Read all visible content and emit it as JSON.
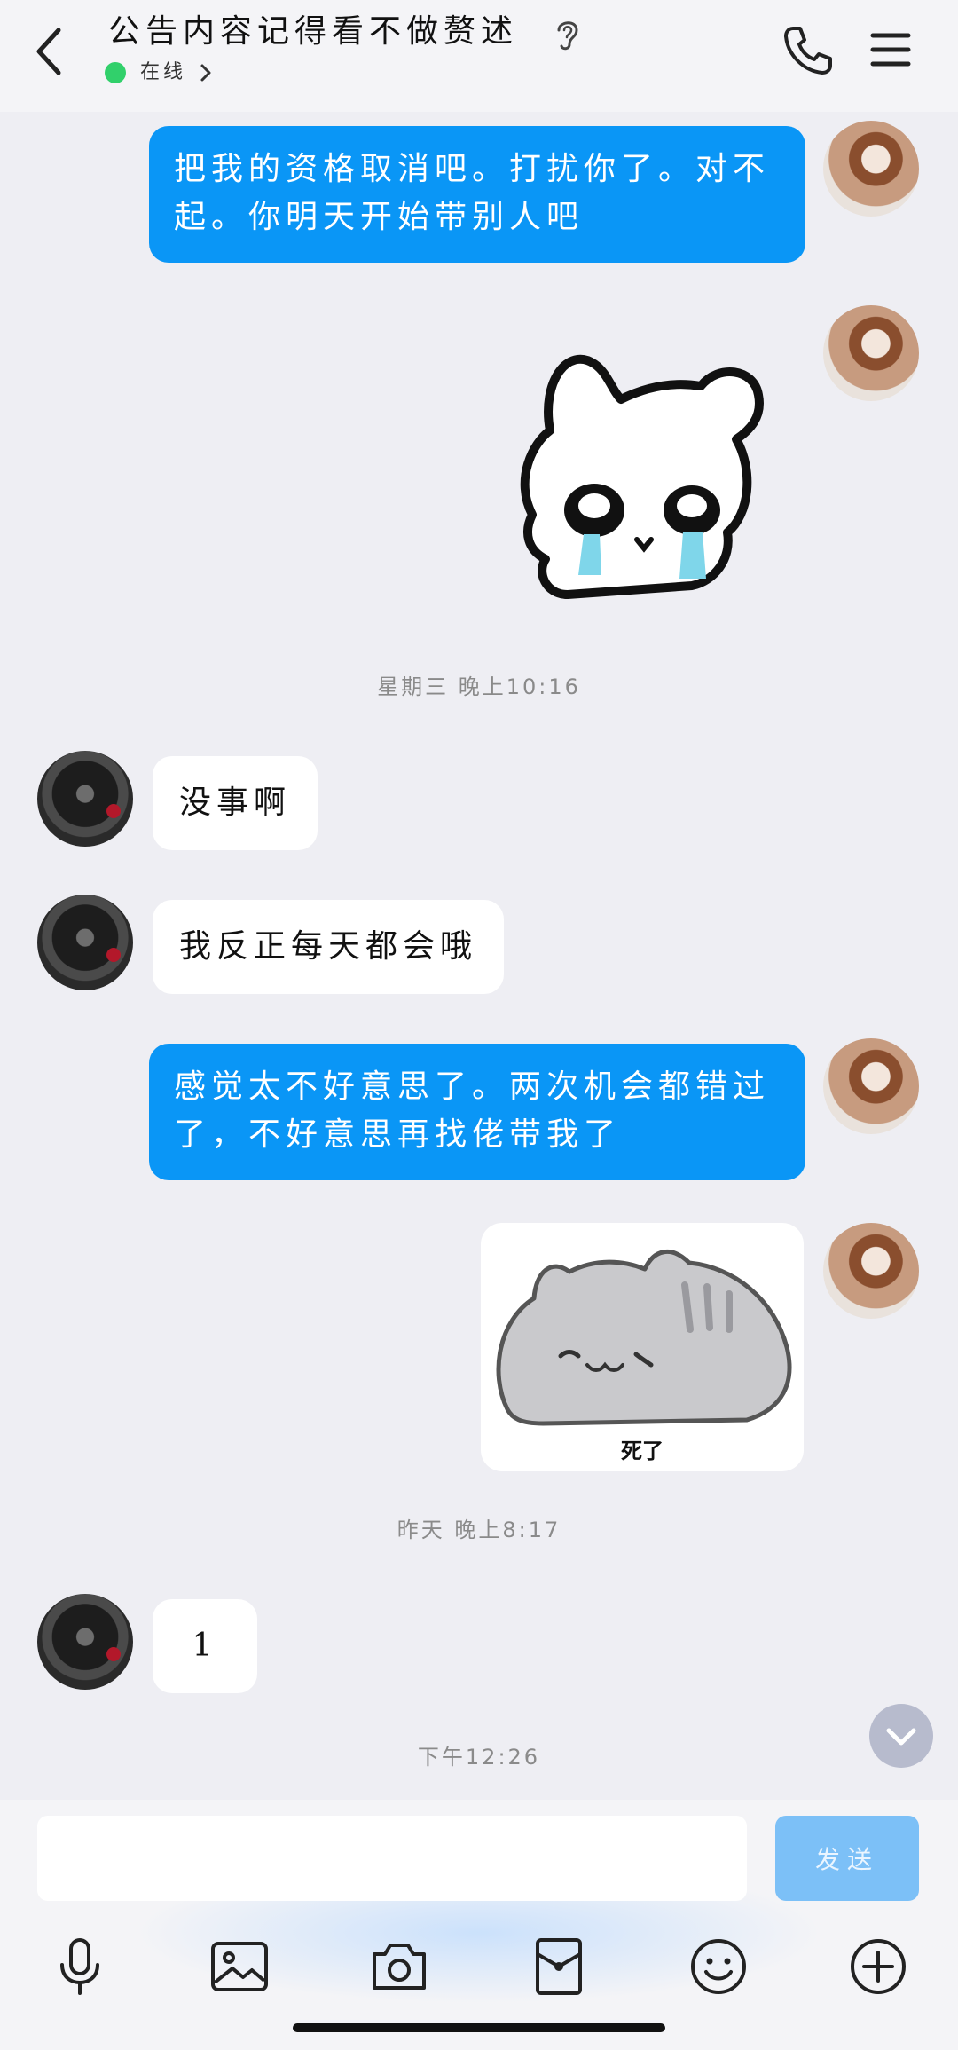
{
  "header": {
    "title": "公告内容记得看不做赘述",
    "status": "在线"
  },
  "messages": [
    {
      "from": "me",
      "type": "text",
      "text": "把我的资格取消吧。打扰你了。对不起。你明天开始带别人吧"
    },
    {
      "from": "me",
      "type": "sticker",
      "icon": "crying-bunny-sticker"
    },
    {
      "type": "timestamp",
      "text": "星期三 晚上10:16"
    },
    {
      "from": "peer",
      "type": "text",
      "text": "没事啊"
    },
    {
      "from": "peer",
      "type": "text",
      "text": "我反正每天都会哦"
    },
    {
      "from": "me",
      "type": "text",
      "text": "感觉太不好意思了。两次机会都错过了，不好意思再找佬带我了"
    },
    {
      "from": "me",
      "type": "sticker",
      "icon": "lying-cat-sticker",
      "caption": "死了"
    },
    {
      "type": "timestamp",
      "text": "昨天 晚上8:17"
    },
    {
      "from": "peer",
      "type": "text",
      "text": "1"
    },
    {
      "type": "timestamp",
      "text": "下午12:26"
    }
  ],
  "input": {
    "placeholder": "",
    "value": "",
    "send_label": "发送"
  },
  "toolbar": [
    "microphone-icon",
    "image-icon",
    "camera-icon",
    "red-packet-icon",
    "emoji-icon",
    "plus-icon"
  ],
  "colors": {
    "my_bubble": "#0a96f6",
    "peer_bubble": "#ffffff",
    "background": "#eeeef3",
    "online": "#31d06b",
    "send_button": "#7cc0f7"
  }
}
